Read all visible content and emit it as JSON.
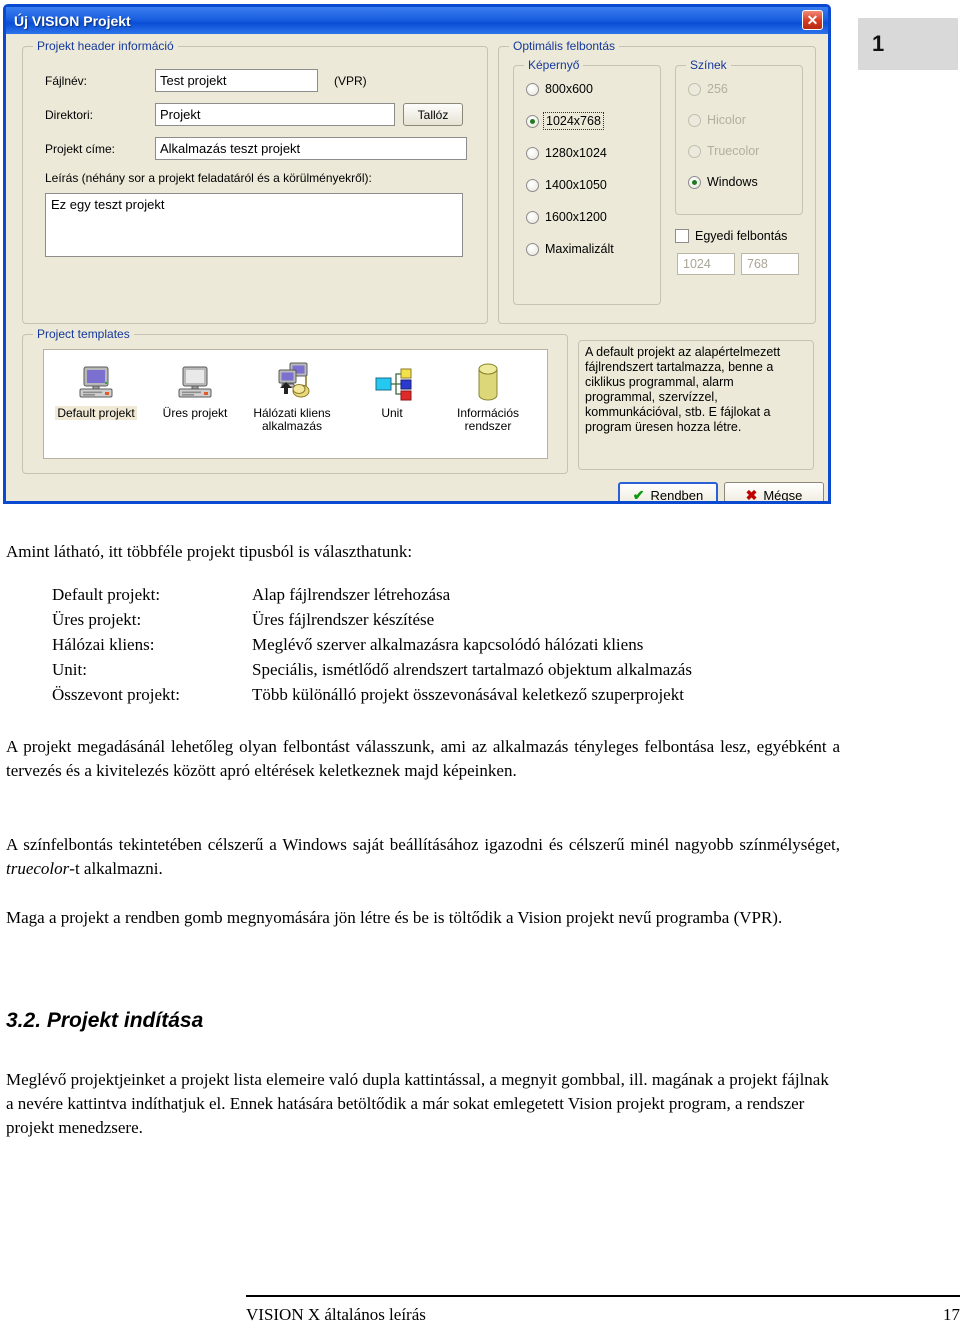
{
  "page_badge": {
    "number": "1"
  },
  "dialog": {
    "title": "Új VISION Projekt",
    "close_label": "✕",
    "header_group": {
      "title": "Projekt header információ",
      "filename_label": "Fájlnév:",
      "filename_value": "Test projekt",
      "filename_ext": "(VPR)",
      "directory_label": "Direktori:",
      "directory_value": "Projekt",
      "browse_button": "Tallóz",
      "project_title_label": "Projekt címe:",
      "project_title_value": "Alkalmazás teszt projekt",
      "description_label": "Leírás (néhány sor a projekt feladatáról és a körülményekről):",
      "description_value": "Ez egy teszt projekt"
    },
    "resolution_group": {
      "title": "Optimális felbontás",
      "screen_group": {
        "title": "Képernyő",
        "options": [
          {
            "label": "800x600",
            "selected": false,
            "focused": false
          },
          {
            "label": "1024x768",
            "selected": true,
            "focused": true
          },
          {
            "label": "1280x1024",
            "selected": false,
            "focused": false
          },
          {
            "label": "1400x1050",
            "selected": false,
            "focused": false
          },
          {
            "label": "1600x1200",
            "selected": false,
            "focused": false
          },
          {
            "label": "Maximalizált",
            "selected": false,
            "focused": false
          }
        ]
      },
      "colors_group": {
        "title": "Színek",
        "options": [
          {
            "label": "256",
            "selected": false,
            "disabled": true
          },
          {
            "label": "Hicolor",
            "selected": false,
            "disabled": true
          },
          {
            "label": "Truecolor",
            "selected": false,
            "disabled": true
          },
          {
            "label": "Windows",
            "selected": true,
            "disabled": false
          }
        ]
      },
      "custom_checkbox_label": "Egyedi felbontás",
      "custom_checkbox_checked": false,
      "custom_width": "1024",
      "custom_height": "768"
    },
    "templates_group": {
      "title": "Project templates",
      "items": [
        {
          "label_line1": "Default projekt",
          "label_line2": "",
          "icon": "desktop-computer-icon",
          "selected": true
        },
        {
          "label_line1": "Üres projekt",
          "label_line2": "",
          "icon": "empty-computer-icon",
          "selected": false
        },
        {
          "label_line1": "Hálózati kliens",
          "label_line2": "alkalmazás",
          "icon": "network-client-icon",
          "selected": false
        },
        {
          "label_line1": "Unit",
          "label_line2": "",
          "icon": "unit-blocks-icon",
          "selected": false
        },
        {
          "label_line1": "Információs",
          "label_line2": "rendszer",
          "icon": "database-cylinder-icon",
          "selected": false
        }
      ]
    },
    "description_pane": "A default projekt az alapértelmezett fájlrendszert tartalmazza, benne a ciklikus programmal, alarm programmal, szervízzel, kommunkációval, stb. E fájlokat a program üresen hozza létre.",
    "ok_button": "Rendben",
    "ok_icon": "✔",
    "cancel_button": "Mégse",
    "cancel_icon": "✖"
  },
  "document": {
    "intro": "Amint látható, itt többféle projekt tipusból is választhatunk:",
    "definitions": [
      {
        "term": "Default projekt:",
        "desc": "Alap fájlrendszer létrehozása"
      },
      {
        "term": "Üres projekt:",
        "desc": "Üres fájlrendszer készítése"
      },
      {
        "term": "Hálózai kliens:",
        "desc": "Meglévő szerver alkalmazásra kapcsolódó hálózati kliens"
      },
      {
        "term": "Unit:",
        "desc": "Speciális, ismétlődő alrendszert tartalmazó objektum alkalmazás"
      },
      {
        "term": "Összevont projekt:",
        "desc": "Több különálló projekt összevonásával keletkező szuperprojekt"
      }
    ],
    "paragraph1": "A projekt megadásánál lehetőleg olyan felbontást válasszunk, ami az alkalmazás tényleges felbontása lesz, egyébként a tervezés és a kivitelezés között apró eltérések keletkeznek majd képeinken.",
    "paragraph2_part1": "A színfelbontás tekintetében célszerű a Windows saját beállításához igazodni és célszerű minél nagyobb színmélységet, ",
    "paragraph2_italic": "truecolor",
    "paragraph2_part2": "-t alkalmazni.",
    "paragraph3": "Maga a projekt a rendben gomb megnyomására jön létre és be is töltődik a Vision projekt nevű programba (VPR).",
    "heading2": "3.2. Projekt indítása",
    "paragraph4": "Meglévő projektjeinket a projekt lista elemeire való dupla kattintással, a megnyit gombbal, ill. magának a projekt fájlnak a nevére kattintva indíthatjuk el. Ennek hatására betöltődik a már sokat emlegetett Vision projekt program, a rendszer projekt menedzsere."
  },
  "footer": {
    "left": "VISION X általános leírás",
    "right": "17"
  }
}
